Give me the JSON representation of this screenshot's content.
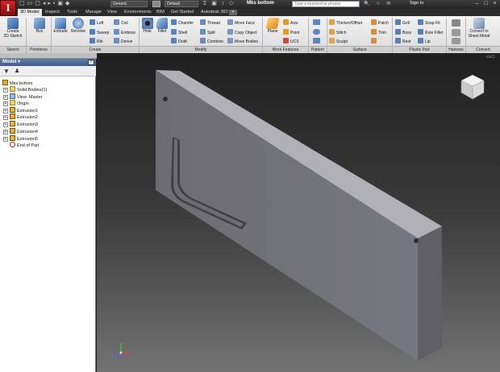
{
  "app": {
    "logo": "I",
    "document_title": "Mks bottom"
  },
  "quick_access": {
    "appearance_value": "Generic",
    "style_value": "Default",
    "search_placeholder": "Type a keyword or phrase",
    "sign_in": "Sign In"
  },
  "tabs": [
    "3D Model",
    "Inspect",
    "Tools",
    "Manage",
    "View",
    "Environments",
    "BIM",
    "Get Started",
    "Autodesk 360"
  ],
  "ribbon": {
    "sketch": {
      "create_2d_sketch": "Create\n2D Sketch",
      "panel": "Sketch"
    },
    "primitives": {
      "box": "Box",
      "panel": "Primitives"
    },
    "create": {
      "extrude": "Extrude",
      "revolve": "Revolve",
      "loft": "Loft",
      "sweep": "Sweep",
      "rib": "Rib",
      "coil": "Coil",
      "emboss": "Emboss",
      "derive": "Derive",
      "panel": "Create"
    },
    "modify": {
      "hole": "Hole",
      "fillet": "Fillet",
      "chamfer": "Chamfer",
      "shell": "Shell",
      "draft": "Draft",
      "thread": "Thread",
      "split": "Split",
      "combine": "Combine",
      "move_face": "Move Face",
      "copy_object": "Copy Object",
      "move_bodies": "Move Bodies",
      "panel": "Modify"
    },
    "work_features": {
      "plane": "Plane",
      "axis": "Axis",
      "point": "Point",
      "ucs": "UCS",
      "panel": "Work Features"
    },
    "pattern": {
      "panel": "Pattern"
    },
    "surface": {
      "thicken_offset": "Thicken/Offset",
      "stitch": "Stitch",
      "sculpt": "Sculpt",
      "patch": "Patch",
      "trim": "Trim",
      "panel": "Surface"
    },
    "plastic_part": {
      "grill": "Grill",
      "boss": "Boss",
      "rest": "Rest",
      "snap_fit": "Snap Fit",
      "rule_fillet": "Rule Fillet",
      "lip": "Lip",
      "panel": "Plastic Part"
    },
    "harness": {
      "panel": "Harness"
    },
    "convert": {
      "convert_to_sheet_metal": "Convert to\nSheet Metal",
      "panel": "Convert"
    }
  },
  "browser": {
    "title": "Model",
    "items": [
      {
        "label": "Mks bottom",
        "icon": "part-icon",
        "level": 0
      },
      {
        "label": "Solid Bodies(1)",
        "icon": "folder-icon",
        "level": 1
      },
      {
        "label": "View: Master",
        "icon": "view-icon",
        "level": 1
      },
      {
        "label": "Origin",
        "icon": "folder-icon",
        "level": 1
      },
      {
        "label": "Extrusion1",
        "icon": "extrusion-icon",
        "level": 1
      },
      {
        "label": "Extrusion2",
        "icon": "extrusion-icon",
        "level": 1
      },
      {
        "label": "Extrusion3",
        "icon": "extrusion-icon",
        "level": 1
      },
      {
        "label": "Extrusion4",
        "icon": "extrusion-icon",
        "level": 1
      },
      {
        "label": "Extrusion5",
        "icon": "extrusion-icon",
        "level": 1
      },
      {
        "label": "End of Part",
        "icon": "end-of-part-icon",
        "level": 1
      }
    ]
  },
  "colors": {
    "app_red": "#c81414",
    "browser_header": "#4d6d98",
    "part_gray": "#8e8e96"
  }
}
